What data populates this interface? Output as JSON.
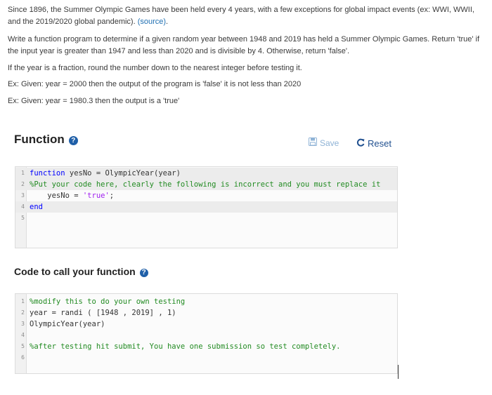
{
  "problem": {
    "p1_text": "Since 1896, the Summer Olympic Games have been held every 4 years, with a few exceptions for global impact events (ex: WWI, WWII, and the 2019/2020 global pandemic). ",
    "p1_link": "(source)",
    "p1_end": ".",
    "p2": "Write a function program to determine if a given random year between 1948 and 2019 has held a Summer Olympic Games. Return 'true' if the input year is greater than 1947 and less than 2020 and is divisible by 4. Otherwise, return 'false'.",
    "p3": "If the year is a fraction, round the number down to the nearest integer before testing it.",
    "p4": "Ex: Given: year = 2000 then the output of the program is 'false' it is not less than 2020",
    "p5": "Ex: Given: year = 1980.3 then the output is a 'true'"
  },
  "function_section": {
    "title": "Function",
    "help_icon": "question-circle-icon",
    "save_label": "Save",
    "reset_label": "Reset",
    "lines": [
      {
        "num": "1",
        "parts": [
          {
            "t": "function",
            "c": "kw"
          },
          {
            "t": " yesNo = OlympicYear(year)",
            "c": ""
          }
        ]
      },
      {
        "num": "2",
        "parts": [
          {
            "t": "%Put your code here, clearly the following is incorrect and you must replace it",
            "c": "cm"
          }
        ]
      },
      {
        "num": "3",
        "parts": [
          {
            "t": "    yesNo = ",
            "c": ""
          },
          {
            "t": "'true'",
            "c": "str"
          },
          {
            "t": ";",
            "c": ""
          }
        ]
      },
      {
        "num": "4",
        "parts": [
          {
            "t": "end",
            "c": "kw"
          }
        ]
      },
      {
        "num": "5",
        "parts": []
      }
    ]
  },
  "call_section": {
    "title": "Code to call your function",
    "help_icon": "question-circle-icon",
    "lines": [
      {
        "num": "1",
        "parts": [
          {
            "t": "%modify this to do your own testing",
            "c": "cm"
          }
        ]
      },
      {
        "num": "2",
        "parts": [
          {
            "t": "year = randi ( [1948 , 2019] , 1)",
            "c": ""
          }
        ]
      },
      {
        "num": "3",
        "parts": [
          {
            "t": "OlympicYear(year)",
            "c": ""
          }
        ]
      },
      {
        "num": "4",
        "parts": []
      },
      {
        "num": "5",
        "parts": [
          {
            "t": "%after testing hit submit, You have one submission so test completely.",
            "c": "cm"
          }
        ]
      },
      {
        "num": "6",
        "parts": []
      }
    ]
  },
  "colors": {
    "link": "#1f6fb2",
    "keyword": "#0000ff",
    "comment": "#228b22",
    "string": "#a020f0"
  }
}
